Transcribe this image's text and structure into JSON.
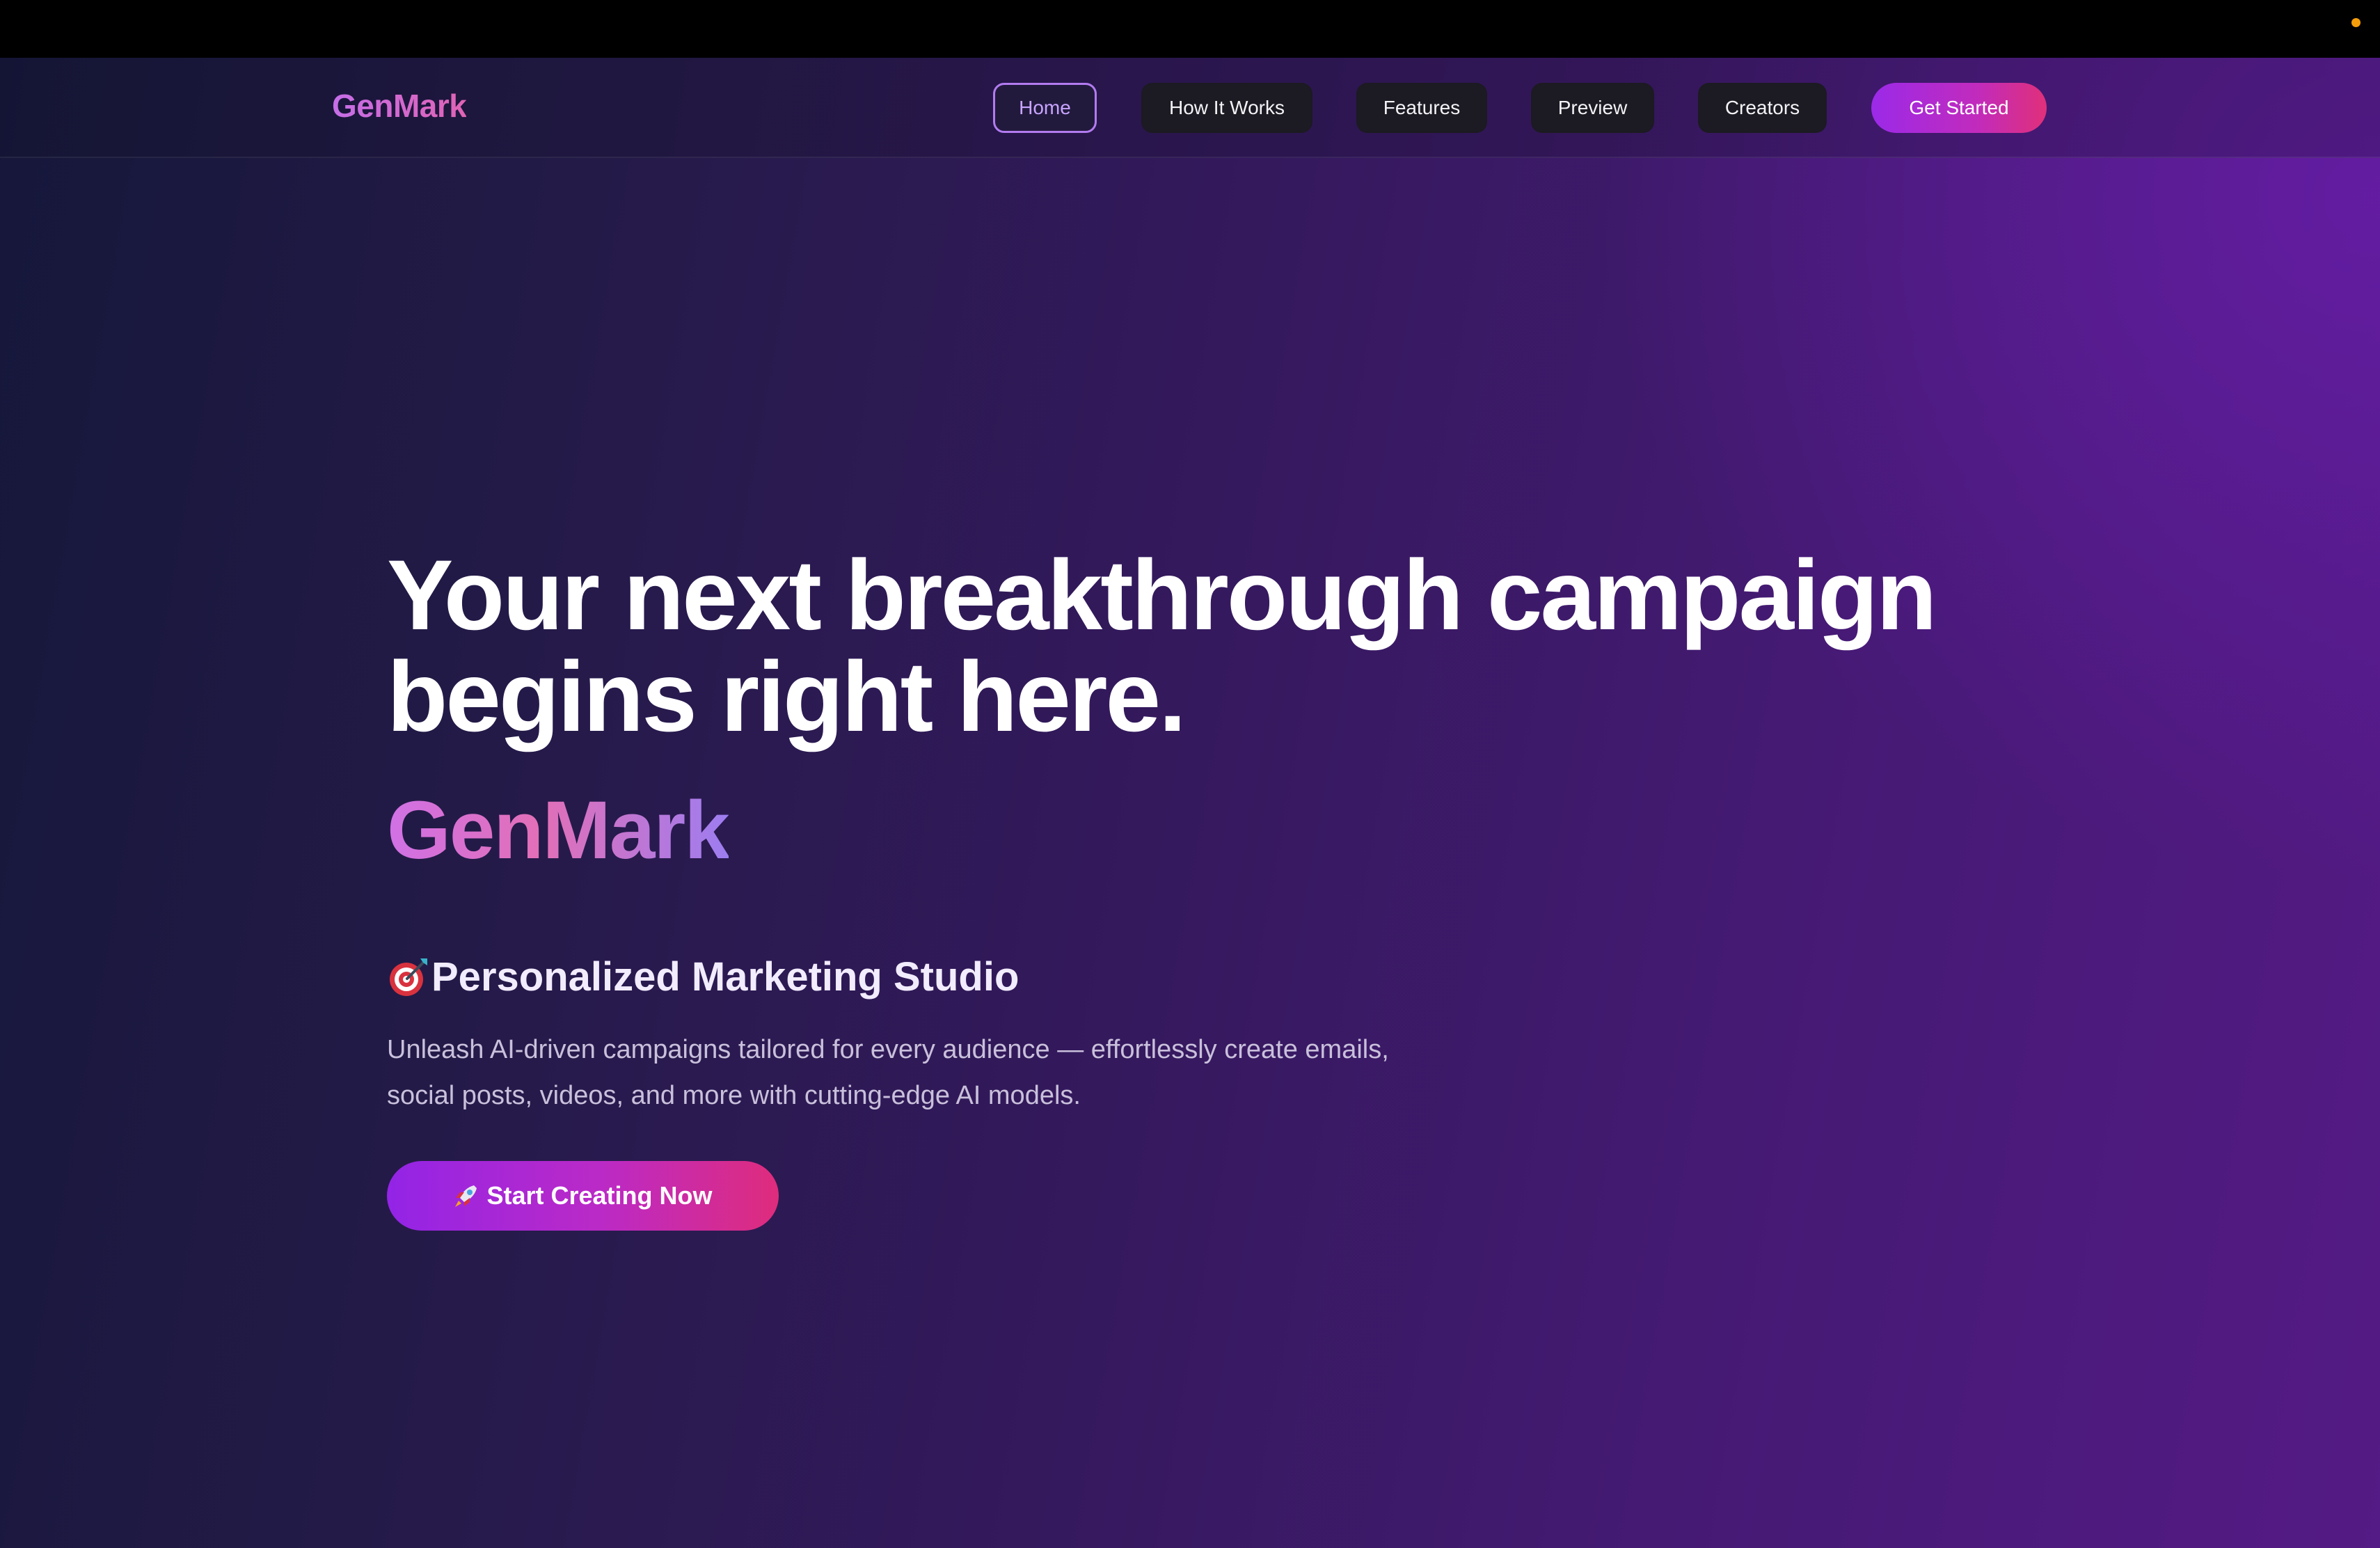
{
  "nav": {
    "logo": "GenMark",
    "items": [
      {
        "label": "Home",
        "active": true
      },
      {
        "label": "How It Works",
        "active": false
      },
      {
        "label": "Features",
        "active": false
      },
      {
        "label": "Preview",
        "active": false
      },
      {
        "label": "Creators",
        "active": false
      }
    ],
    "cta_label": "Get Started"
  },
  "hero": {
    "headline_line1": "Your next breakthrough campaign",
    "headline_line2": "begins right here.",
    "brand": "GenMark",
    "subtitle_icon": "target-icon",
    "subtitle": "Personalized Marketing Studio",
    "description_line1": "Unleash AI-driven campaigns tailored for every audience — effortlessly create emails,",
    "description_line2": "social posts, videos, and more with cutting-edge AI models.",
    "cta_icon": "rocket-icon",
    "cta_label": "Start Creating Now"
  },
  "colors": {
    "accent_purple": "#9b2ae8",
    "accent_pink": "#e0307a",
    "status_dot": "#f59e0b"
  }
}
